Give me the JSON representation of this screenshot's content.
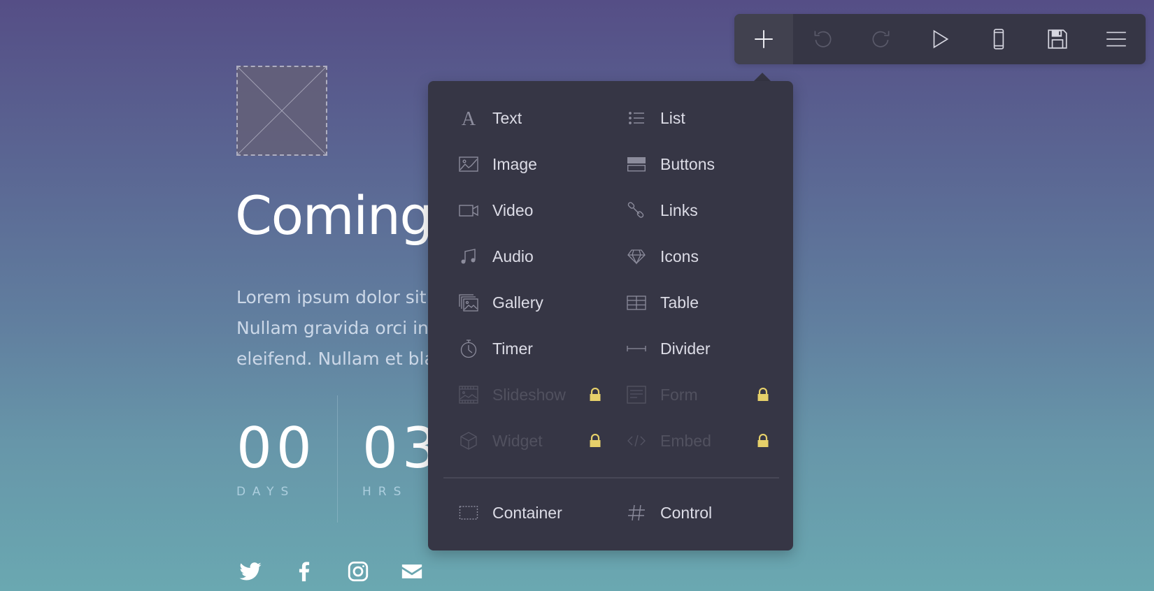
{
  "page": {
    "headline": "Coming",
    "lorem": "Lorem ipsum dolor sit\nNullam gravida orci in\neleifend. Nullam et bla",
    "counters": [
      {
        "value": "00",
        "label": "DAYS"
      },
      {
        "value": "03",
        "label": "HRS"
      }
    ],
    "socials": [
      "twitter-icon",
      "facebook-icon",
      "instagram-icon",
      "email-icon"
    ]
  },
  "toolbar": {
    "buttons": [
      {
        "name": "add",
        "icon": "plus-icon",
        "active": true
      },
      {
        "name": "undo",
        "icon": "undo-icon",
        "disabled": true
      },
      {
        "name": "redo",
        "icon": "redo-icon",
        "disabled": true
      },
      {
        "name": "preview",
        "icon": "play-icon"
      },
      {
        "name": "mobile-view",
        "icon": "mobile-icon"
      },
      {
        "name": "save",
        "icon": "save-icon"
      },
      {
        "name": "menu",
        "icon": "hamburger-icon"
      }
    ]
  },
  "add_menu": {
    "items": [
      {
        "label": "Text",
        "icon": "text-icon",
        "locked": false
      },
      {
        "label": "List",
        "icon": "list-icon",
        "locked": false
      },
      {
        "label": "Image",
        "icon": "image-icon",
        "locked": false
      },
      {
        "label": "Buttons",
        "icon": "buttons-icon",
        "locked": false
      },
      {
        "label": "Video",
        "icon": "video-icon",
        "locked": false
      },
      {
        "label": "Links",
        "icon": "link-icon",
        "locked": false
      },
      {
        "label": "Audio",
        "icon": "music-note-icon",
        "locked": false
      },
      {
        "label": "Icons",
        "icon": "diamond-icon",
        "locked": false
      },
      {
        "label": "Gallery",
        "icon": "gallery-icon",
        "locked": false
      },
      {
        "label": "Table",
        "icon": "table-icon",
        "locked": false
      },
      {
        "label": "Timer",
        "icon": "stopwatch-icon",
        "locked": false
      },
      {
        "label": "Divider",
        "icon": "divider-icon",
        "locked": false
      },
      {
        "label": "Slideshow",
        "icon": "slideshow-icon",
        "locked": true
      },
      {
        "label": "Form",
        "icon": "form-icon",
        "locked": true
      },
      {
        "label": "Widget",
        "icon": "cube-icon",
        "locked": true
      },
      {
        "label": "Embed",
        "icon": "code-icon",
        "locked": true
      }
    ],
    "footer_items": [
      {
        "label": "Container",
        "icon": "dashed-box-icon"
      },
      {
        "label": "Control",
        "icon": "hash-icon"
      }
    ],
    "lock_color": "#e6d06a"
  },
  "colors": {
    "panel": "#363645",
    "bg_top": "#554e86",
    "bg_bottom": "#6aa8b1"
  }
}
